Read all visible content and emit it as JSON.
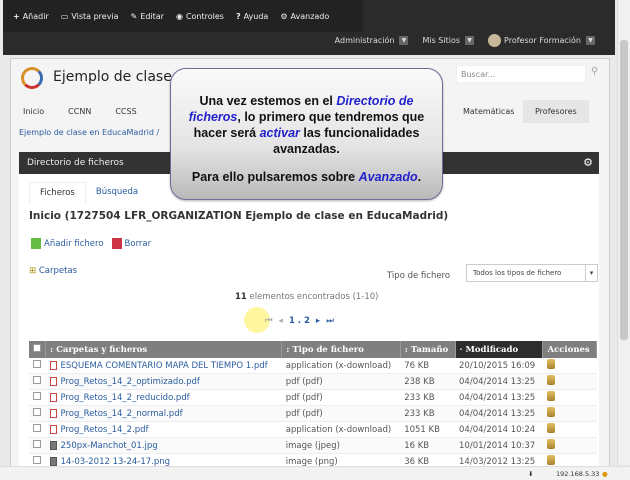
{
  "toolbar": {
    "add": "Añadir",
    "preview": "Vista previa",
    "edit": "Editar",
    "controls": "Controles",
    "help": "Ayuda",
    "advanced": "Avanzado"
  },
  "userbar": {
    "admin": "Administración",
    "sites": "Mis Sitios",
    "user": "Profesor Formación"
  },
  "site": {
    "title": "Ejemplo de clase en EducaMadrid",
    "search_placeholder": "Buscar..."
  },
  "nav": [
    "Inicio",
    "CCNN",
    "CCSS",
    "Matemáticas",
    "Profesores"
  ],
  "breadcrumb": "Ejemplo de clase en EducaMadrid /",
  "portlet": {
    "title": "Directorio de ficheros",
    "tabs": [
      "Ficheros",
      "Búsqueda"
    ],
    "heading": "Inicio (1727504 LFR_ORGANIZATION Ejemplo de clase en EducaMadrid)",
    "add_file": "Añadir fichero",
    "delete": "Borrar",
    "folders": "Carpetas",
    "file_type_label": "Tipo de fichero",
    "file_type_value": "Todos los tipos de fichero",
    "found_count": "11",
    "found_text": "elementos encontrados (1-10)",
    "pages": "1 . 2"
  },
  "table": {
    "headers": [
      "Carpetas y ficheros",
      "Tipo de fichero",
      "Tamaño",
      "Modificado",
      "Acciones"
    ],
    "rows": [
      {
        "name": "ESQUEMA COMENTARIO MAPA DEL TIEMPO 1.pdf",
        "type": "application (x-download)",
        "size": "76 KB",
        "date": "20/10/2015 16:09",
        "kind": "pdf"
      },
      {
        "name": "Prog_Retos_14_2_optimizado.pdf",
        "type": "pdf (pdf)",
        "size": "238 KB",
        "date": "04/04/2014 13:25",
        "kind": "pdf"
      },
      {
        "name": "Prog_Retos_14_2_reducido.pdf",
        "type": "pdf (pdf)",
        "size": "233 KB",
        "date": "04/04/2014 13:25",
        "kind": "pdf"
      },
      {
        "name": "Prog_Retos_14_2_normal.pdf",
        "type": "pdf (pdf)",
        "size": "233 KB",
        "date": "04/04/2014 13:25",
        "kind": "pdf"
      },
      {
        "name": "Prog_Retos_14_2.pdf",
        "type": "application (x-download)",
        "size": "1051 KB",
        "date": "04/04/2014 10:24",
        "kind": "pdf"
      },
      {
        "name": "250px-Manchot_01.jpg",
        "type": "image (jpeg)",
        "size": "16 KB",
        "date": "10/01/2014 10:37",
        "kind": "img"
      },
      {
        "name": "14-03-2012 13-24-17.png",
        "type": "image (png)",
        "size": "36 KB",
        "date": "14/03/2012 13:25",
        "kind": "img"
      }
    ]
  },
  "status": {
    "ip": "192.168.5.33"
  },
  "bubble": {
    "t1": "Una vez estemos en el ",
    "t2": "Directorio de ficheros",
    "t3": ", lo primero que tendremos que hacer será ",
    "t4": "activar",
    "t5": " las funcionalidades avanzadas.",
    "t6": "Para ello pulsaremos sobre ",
    "t7": "Avanzado",
    "t8": "."
  }
}
